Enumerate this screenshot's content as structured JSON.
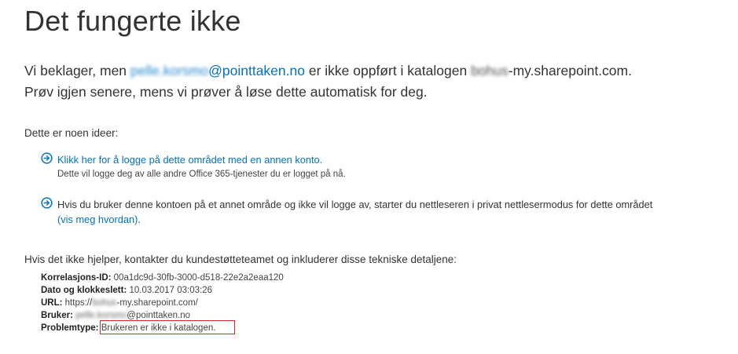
{
  "page": {
    "title": "Det fungerte ikke",
    "message": {
      "part1": "Vi beklager, men ",
      "user_blurred": "pelle.korsmo",
      "user_domain": "@pointtaken.no",
      "part2": " er ikke oppført i katalogen ",
      "site_blurred": "bohus",
      "site_domain": "-my.sharepoint.com.",
      "line2": "Prøv igjen senere, mens vi prøver å løse dette automatisk for deg."
    },
    "ideas": {
      "heading": "Dette er noen ideer:",
      "items": [
        {
          "icon": "arrow-circle-right-icon",
          "link": "Klikk her for å logge på dette området med en annen konto.",
          "sub": "Dette vil logge deg av alle andre Office 365-tjenester du er logget på nå."
        },
        {
          "icon": "arrow-circle-right-icon",
          "text": "Hvis du bruker denne kontoen på et annet område og ikke vil logge av, starter du nettleseren i privat nettlesermodus for dette området",
          "link": "(vis meg hvordan)",
          "suffix": "."
        }
      ]
    },
    "help": {
      "heading": "Hvis det ikke hjelper, kontakter du kundestøtteteamet og inkluderer disse tekniske detaljene:"
    },
    "details": {
      "correlation_label": "Korrelasjons-ID:",
      "correlation_value": " 00a1dc9d-30fb-3000-d518-22e2a2eaa120",
      "date_label": "Dato og klokkeslett:",
      "date_value": " 10.03.2017 03:03:26",
      "url_label": "URL:",
      "url_prefix": " https://",
      "url_blurred": "bohus",
      "url_suffix": "-my.sharepoint.com/",
      "user_label": "Bruker:",
      "user_blurred": " pelle.korsmo",
      "user_suffix": "@pointtaken.no",
      "problem_label": "Problemtype:",
      "problem_value": " Brukeren er ikke i katalogen."
    },
    "colors": {
      "link": "#0072c6",
      "text": "#333333",
      "highlight_box": "#d0272c"
    }
  }
}
